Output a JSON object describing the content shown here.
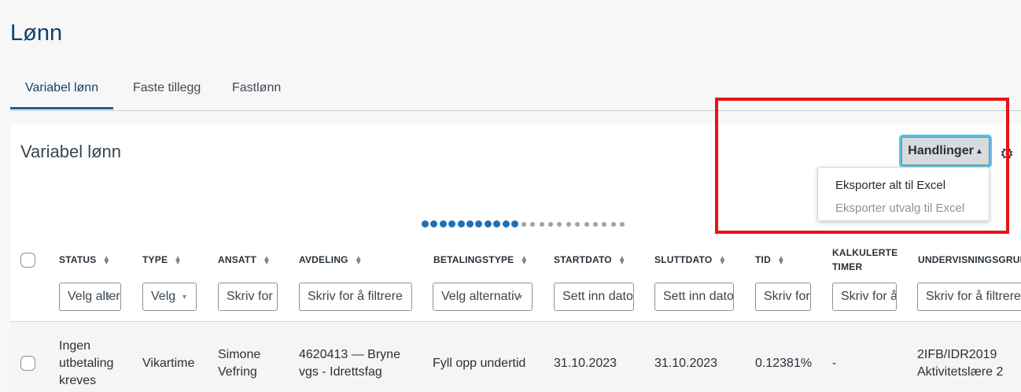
{
  "page": {
    "title": "Lønn"
  },
  "tabs": [
    {
      "label": "Variabel lønn"
    },
    {
      "label": "Faste tillegg"
    },
    {
      "label": "Fastlønn"
    }
  ],
  "card": {
    "title": "Variabel lønn",
    "actions_label": "Handlinger",
    "menu": [
      {
        "label": "Eksporter alt til Excel"
      },
      {
        "label": "Eksporter utvalg til Excel"
      }
    ]
  },
  "columns": [
    {
      "header": "STATUS",
      "filter": "Velg alternativ"
    },
    {
      "header": "TYPE",
      "filter": "Velg"
    },
    {
      "header": "ANSATT",
      "filter": "Skriv for å filtrere"
    },
    {
      "header": "AVDELING",
      "filter": "Skriv for å filtrere"
    },
    {
      "header": "BETALINGSTYPE",
      "filter": "Velg alternativ"
    },
    {
      "header": "STARTDATO",
      "filter": "Sett inn dato"
    },
    {
      "header": "SLUTTDATO",
      "filter": "Sett inn dato"
    },
    {
      "header": "TID",
      "filter": "Skriv for å filtrere"
    },
    {
      "header1": "KALKULERTE",
      "header2": "TIMER",
      "filter": "Skriv for å filtrere"
    },
    {
      "header": "UNDERVISNINGSGRUPPE",
      "filter": "Skriv for å filtrere"
    }
  ],
  "rows": [
    {
      "status": [
        "Ingen",
        "utbetaling",
        "kreves"
      ],
      "type": "Vikartime",
      "ansatt": [
        "Simone",
        "Vefring"
      ],
      "avdeling": [
        "4620413 — Bryne",
        "vgs - Idrettsfag"
      ],
      "betalingstype": "Fyll opp undertid",
      "startdato": "31.10.2023",
      "sluttdato": "31.10.2023",
      "tid": "0.12381%",
      "kalkulerte_timer": "-",
      "undervisningsgruppe": [
        "2IFB/IDR2019",
        "Aktivitetslære 2"
      ]
    }
  ]
}
